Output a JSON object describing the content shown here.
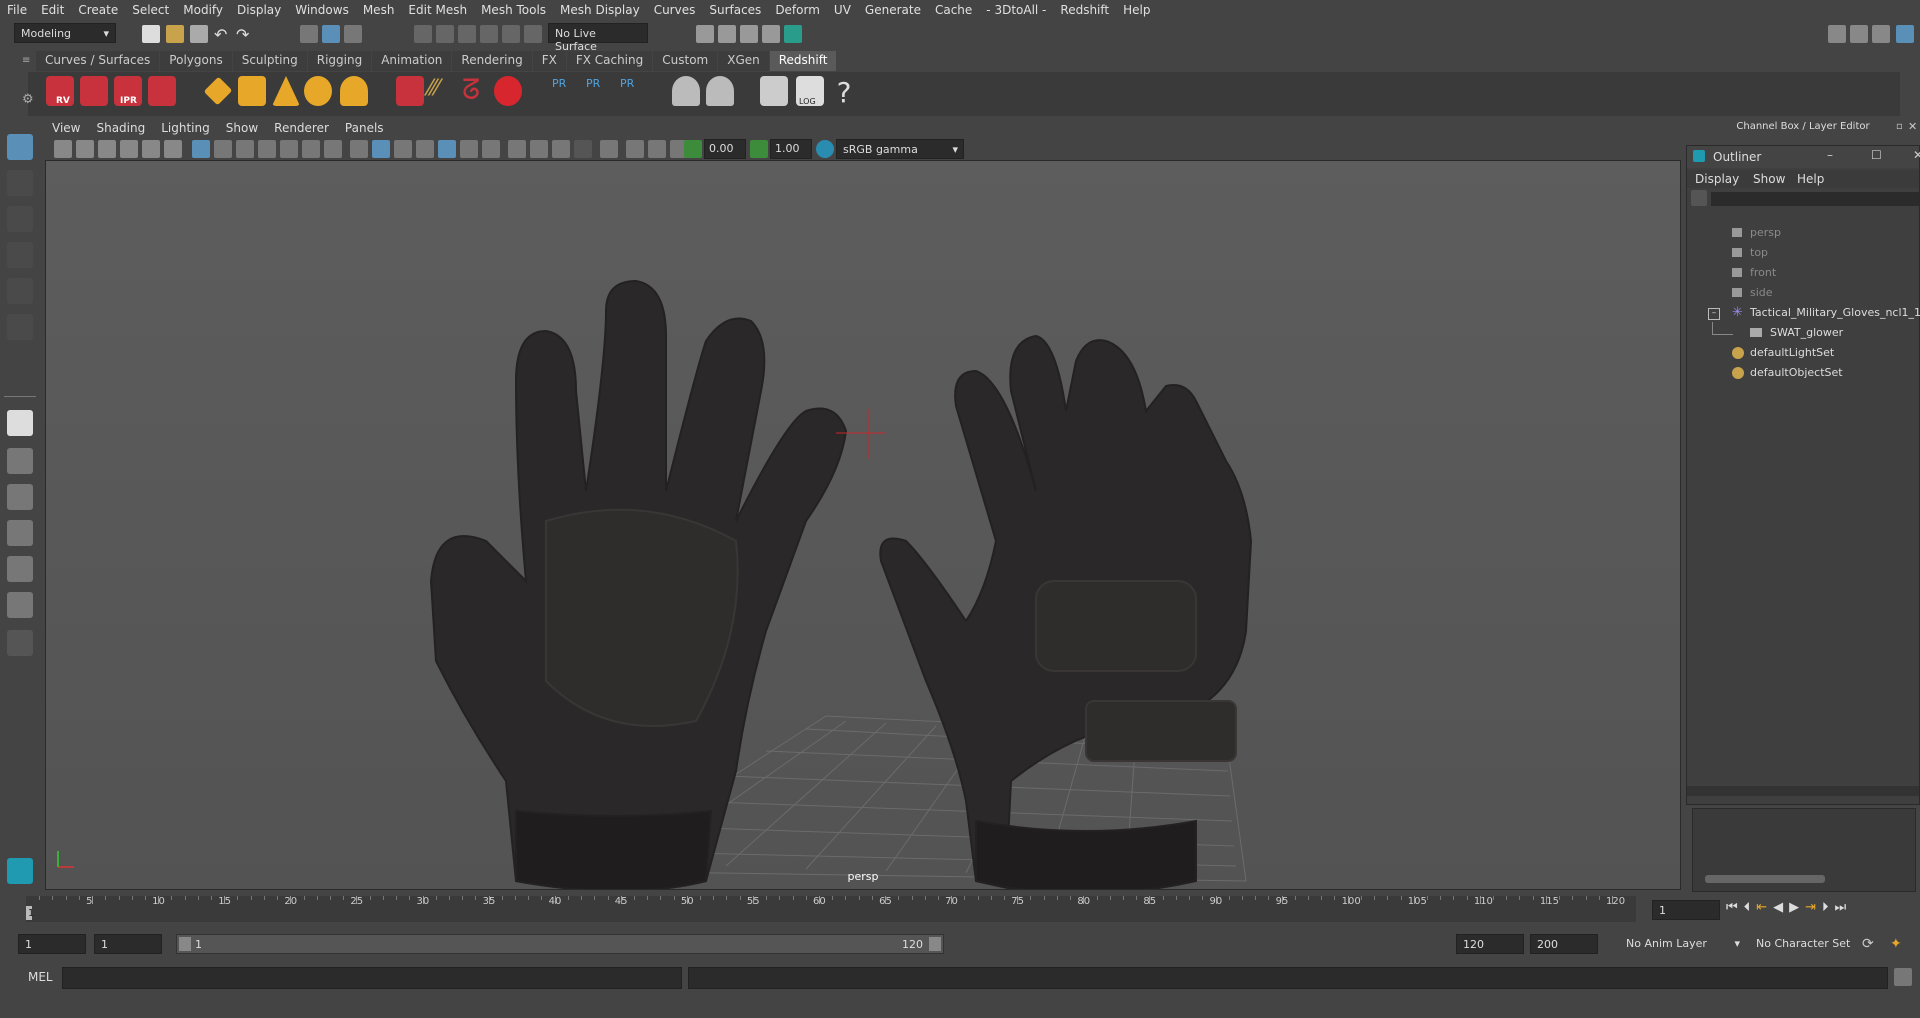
{
  "menus": [
    "File",
    "Edit",
    "Create",
    "Select",
    "Modify",
    "Display",
    "Windows",
    "Mesh",
    "Edit Mesh",
    "Mesh Tools",
    "Mesh Display",
    "Curves",
    "Surfaces",
    "Deform",
    "UV",
    "Generate",
    "Cache",
    "- 3DtoAll -",
    "Redshift",
    "Help"
  ],
  "status": {
    "mode": "Modeling",
    "live_surface": "No Live Surface"
  },
  "shelf_tabs": [
    "Curves / Surfaces",
    "Polygons",
    "Sculpting",
    "Rigging",
    "Animation",
    "Rendering",
    "FX",
    "FX Caching",
    "Custom",
    "XGen",
    "Redshift"
  ],
  "shelf_active": "Redshift",
  "shelf_icon_labels": {
    "rv": "RV",
    "ipr": "IPR",
    "pr1": "PR",
    "pr2": "PR",
    "pr3": "PR",
    "log": "LOG",
    "help": "?"
  },
  "viewport": {
    "menus": [
      "View",
      "Shading",
      "Lighting",
      "Show",
      "Renderer",
      "Panels"
    ],
    "exposure": "0.00",
    "gamma": "1.00",
    "color_space": "sRGB gamma",
    "camera_label": "persp"
  },
  "right_panel": {
    "header": "Channel Box / Layer Editor"
  },
  "outliner": {
    "title": "Outliner",
    "menus": [
      "Display",
      "Show",
      "Help"
    ],
    "items": [
      {
        "label": "persp",
        "icon": "camera-icon",
        "dim": true
      },
      {
        "label": "top",
        "icon": "camera-icon",
        "dim": true
      },
      {
        "label": "front",
        "icon": "camera-icon",
        "dim": true
      },
      {
        "label": "side",
        "icon": "camera-icon",
        "dim": true
      },
      {
        "label": "Tactical_Military_Gloves_ncl1_1",
        "icon": "group-icon",
        "dim": false
      },
      {
        "label": "SWAT_glower",
        "icon": "mesh-icon",
        "dim": false
      },
      {
        "label": "defaultLightSet",
        "icon": "set-icon",
        "dim": false
      },
      {
        "label": "defaultObjectSet",
        "icon": "set-icon",
        "dim": false
      }
    ]
  },
  "timeline": {
    "ticks": [
      "5",
      "10",
      "15",
      "20",
      "25",
      "30",
      "35",
      "40",
      "45",
      "50",
      "55",
      "60",
      "65",
      "70",
      "75",
      "80",
      "85",
      "90",
      "95",
      "100",
      "105",
      "110",
      "115",
      "120"
    ],
    "current_frame": "1",
    "current_frame_marker": "1"
  },
  "range": {
    "start": "1",
    "start_inner": "1",
    "range_start": "1",
    "range_end": "120",
    "end_inner": "120",
    "end": "200",
    "anim_layer": "No Anim Layer",
    "character_set": "No Character Set"
  },
  "command_line": {
    "label": "MEL"
  }
}
